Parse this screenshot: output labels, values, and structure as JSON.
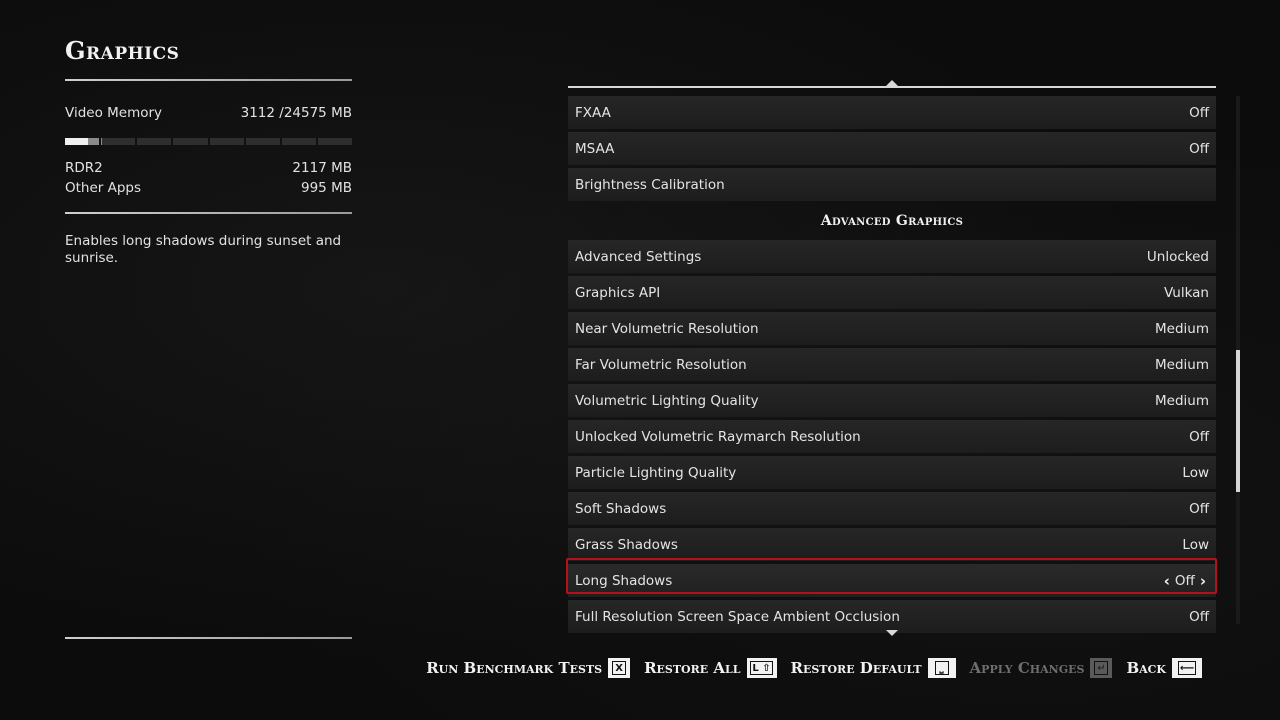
{
  "page": {
    "title": "Graphics"
  },
  "vram": {
    "label": "Video Memory",
    "used": "3112",
    "separator": "/",
    "total": "24575",
    "unit": "MB",
    "usage_fraction": 0.127,
    "rdr2_fraction": 0.086,
    "segments": 8,
    "breakdown": [
      {
        "label": "RDR2",
        "value": "2117",
        "unit": "MB"
      },
      {
        "label": "Other Apps",
        "value": "995",
        "unit": "MB"
      }
    ]
  },
  "description": "Enables long shadows during sunset and sunrise.",
  "settings": {
    "rows": [
      {
        "label": "FXAA",
        "value": "Off"
      },
      {
        "label": "MSAA",
        "value": "Off"
      },
      {
        "label": "Brightness Calibration",
        "value": ""
      },
      {
        "section": "Advanced Graphics"
      },
      {
        "label": "Advanced Settings",
        "value": "Unlocked"
      },
      {
        "label": "Graphics API",
        "value": "Vulkan"
      },
      {
        "label": "Near Volumetric Resolution",
        "value": "Medium"
      },
      {
        "label": "Far Volumetric Resolution",
        "value": "Medium"
      },
      {
        "label": "Volumetric Lighting Quality",
        "value": "Medium"
      },
      {
        "label": "Unlocked Volumetric Raymarch Resolution",
        "value": "Off"
      },
      {
        "label": "Particle Lighting Quality",
        "value": "Low"
      },
      {
        "label": "Soft Shadows",
        "value": "Off"
      },
      {
        "label": "Grass Shadows",
        "value": "Low"
      },
      {
        "label": "Long Shadows",
        "value": "Off",
        "selected": true
      },
      {
        "label": "Full Resolution Screen Space Ambient Occlusion",
        "value": "Off"
      }
    ],
    "selected_color": "#b3121c"
  },
  "footer": {
    "buttons": [
      {
        "label": "Run Benchmark Tests",
        "key": "X",
        "enabled": true,
        "icon": "x-key-icon"
      },
      {
        "label": "Restore All",
        "key": "L ⇧",
        "enabled": true,
        "icon": "shift-key-icon"
      },
      {
        "label": "Restore Default",
        "key": "⎵",
        "enabled": true,
        "icon": "space-key-icon"
      },
      {
        "label": "Apply Changes",
        "key": "↵",
        "enabled": false,
        "icon": "enter-key-icon"
      },
      {
        "label": "Back",
        "key": "⟵",
        "enabled": true,
        "icon": "backspace-key-icon"
      }
    ]
  }
}
